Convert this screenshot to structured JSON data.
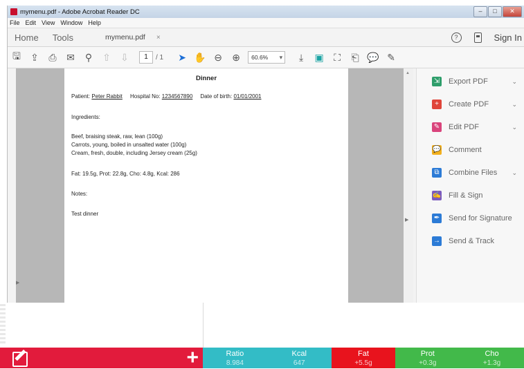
{
  "window": {
    "title": "mymenu.pdf - Adobe Acrobat Reader DC",
    "menu": [
      "File",
      "Edit",
      "View",
      "Window",
      "Help"
    ],
    "tabs": {
      "home": "Home",
      "tools": "Tools",
      "doc": "mymenu.pdf",
      "close": "×",
      "signin": "Sign In"
    }
  },
  "toolbar": {
    "page_current": "1",
    "page_total": "/ 1",
    "zoom": "60.6%"
  },
  "document": {
    "heading": "Dinner",
    "patient_label": "Patient:",
    "patient_name": "Peter Rabbit",
    "hospital_label": "Hospital No:",
    "hospital_no": "1234567890",
    "dob_label": "Date of birth:",
    "dob": "01/01/2001",
    "ingredients_label": "Ingredients:",
    "ingredients": [
      "Beef, braising steak, raw, lean (100g)",
      "Carrots, young, boiled in unsalted water (100g)",
      "Cream, fresh, double, including Jersey cream (25g)"
    ],
    "nutrition": "Fat: 19.5g, Prot: 22.8g, Cho: 4.8g, Kcal: 286",
    "notes_label": "Notes:",
    "notes": "Test dinner"
  },
  "panel": {
    "items": [
      {
        "label": "Export PDF",
        "icon": "export-pdf-icon",
        "color": "#2f9e6b",
        "chevron": true
      },
      {
        "label": "Create PDF",
        "icon": "create-pdf-icon",
        "color": "#e0453a",
        "chevron": true
      },
      {
        "label": "Edit PDF",
        "icon": "edit-pdf-icon",
        "color": "#d9447c",
        "chevron": true
      },
      {
        "label": "Comment",
        "icon": "comment-icon",
        "color": "#f2b01e",
        "chevron": false
      },
      {
        "label": "Combine Files",
        "icon": "combine-files-icon",
        "color": "#2c7bd6",
        "chevron": true
      },
      {
        "label": "Fill & Sign",
        "icon": "fill-sign-icon",
        "color": "#7b5bbf",
        "chevron": false
      },
      {
        "label": "Send for Signature",
        "icon": "send-signature-icon",
        "color": "#2c7bd6",
        "chevron": false
      },
      {
        "label": "Send & Track",
        "icon": "send-track-icon",
        "color": "#2c7bd6",
        "chevron": false
      }
    ]
  },
  "bottom_bar": {
    "accent": "#e21b3c",
    "stats": [
      {
        "label": "Ratio",
        "value": "8.984",
        "color": "#33bcc6"
      },
      {
        "label": "Kcal",
        "value": "647",
        "color": "#33bcc6"
      },
      {
        "label": "Fat",
        "value": "+5.5g",
        "color": "#e8131d"
      },
      {
        "label": "Prot",
        "value": "+0.3g",
        "color": "#42b94a"
      },
      {
        "label": "Cho",
        "value": "+1.3g",
        "color": "#42b94a"
      }
    ]
  }
}
